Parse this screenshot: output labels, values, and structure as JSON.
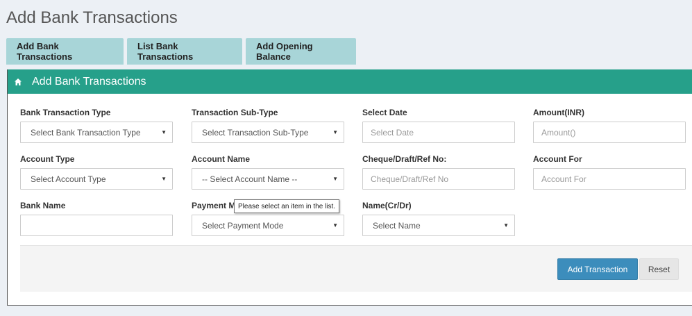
{
  "page": {
    "title": "Add Bank Transactions"
  },
  "tabs": [
    {
      "label": "Add Bank Transactions"
    },
    {
      "label": "List Bank Transactions"
    },
    {
      "label": "Add Opening Balance"
    }
  ],
  "panel": {
    "title": "Add Bank Transactions",
    "icon": "home-icon",
    "header_color": "#26a08a"
  },
  "form": {
    "bank_transaction_type": {
      "label": "Bank Transaction Type",
      "value": "Select Bank Transaction Type"
    },
    "transaction_sub_type": {
      "label": "Transaction Sub-Type",
      "value": "Select Transaction Sub-Type"
    },
    "select_date": {
      "label": "Select Date",
      "placeholder": "Select Date"
    },
    "amount": {
      "label": "Amount(INR)",
      "placeholder": "Amount()"
    },
    "account_type": {
      "label": "Account Type",
      "value": "Select Account Type"
    },
    "account_name": {
      "label": "Account Name",
      "value": "-- Select Account Name --"
    },
    "cheque_ref": {
      "label": "Cheque/Draft/Ref No:",
      "placeholder": "Cheque/Draft/Ref No"
    },
    "account_for": {
      "label": "Account For",
      "placeholder": "Account For"
    },
    "bank_name": {
      "label": "Bank Name",
      "placeholder": ""
    },
    "payment_mode": {
      "label": "Payment Mode",
      "value": "Select Payment Mode"
    },
    "name_cr_dr": {
      "label": "Name(Cr/Dr)",
      "value": "Select Name"
    }
  },
  "tooltip": {
    "text": "Please select an item in the list."
  },
  "actions": {
    "submit_label": "Add Transaction",
    "reset_label": "Reset",
    "primary_color": "#3c8dbc"
  }
}
